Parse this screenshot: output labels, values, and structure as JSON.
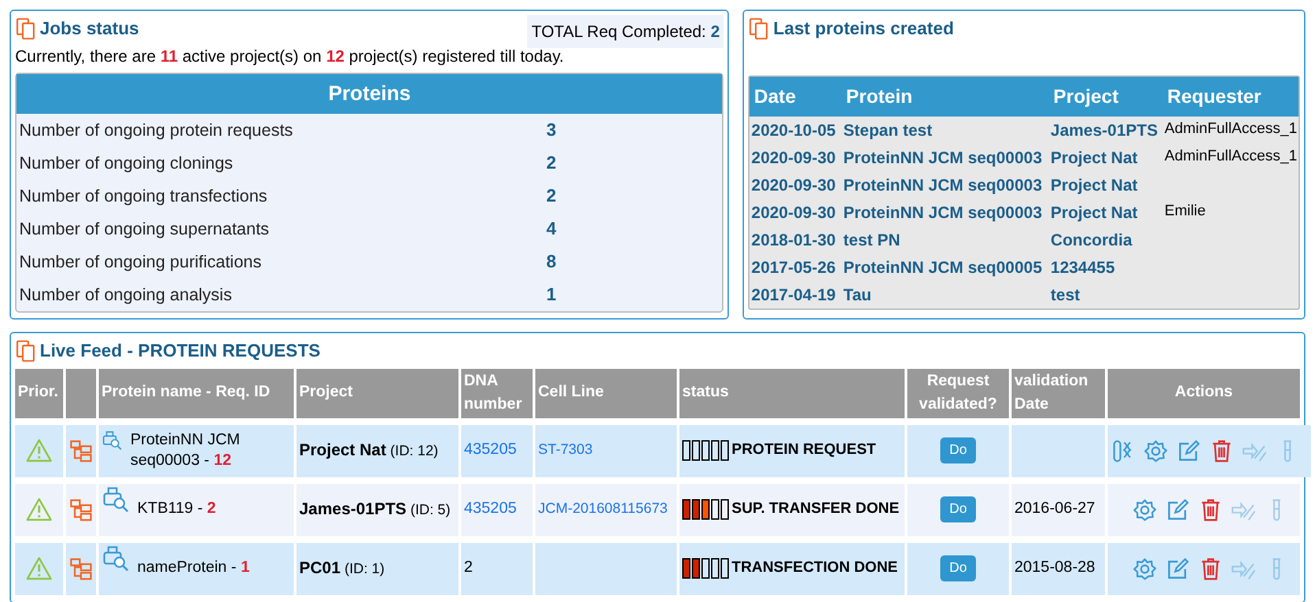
{
  "jobs_status": {
    "title": "Jobs status",
    "total_label": "TOTAL Req Completed:",
    "total_value": "2",
    "summary": {
      "before": "Currently, there are",
      "active": "11",
      "middle": "active project(s) on",
      "registered": "12",
      "after": "project(s) registered till today."
    },
    "table_title": "Proteins",
    "rows": [
      {
        "label": "Number of ongoing protein requests",
        "value": "3"
      },
      {
        "label": "Number of ongoing clonings",
        "value": "2"
      },
      {
        "label": "Number of ongoing transfections",
        "value": "2"
      },
      {
        "label": "Number of ongoing supernatants",
        "value": "4"
      },
      {
        "label": "Number of ongoing purifications",
        "value": "8"
      },
      {
        "label": "Number of ongoing analysis",
        "value": "1"
      }
    ]
  },
  "last_proteins": {
    "title": "Last proteins created",
    "columns": [
      "Date",
      "Protein",
      "Project",
      "Requester"
    ],
    "rows": [
      [
        "2020-10-05",
        "Stepan test",
        "James-01PTS",
        "AdminFullAccess_1"
      ],
      [
        "2020-09-30",
        "ProteinNN JCM seq00003",
        "Project Nat",
        "AdminFullAccess_1"
      ],
      [
        "2020-09-30",
        "ProteinNN JCM seq00003",
        "Project Nat",
        ""
      ],
      [
        "2020-09-30",
        "ProteinNN JCM seq00003",
        "Project Nat",
        "Emilie"
      ],
      [
        "2018-01-30",
        "test PN",
        "Concordia",
        ""
      ],
      [
        "2017-05-26",
        "ProteinNN JCM seq00005",
        "1234455",
        ""
      ],
      [
        "2017-04-19",
        "Tau",
        "test",
        ""
      ]
    ]
  },
  "live_feed": {
    "title": "Live Feed - PROTEIN REQUESTS",
    "columns": [
      "Prior.",
      "",
      "Protein name - Req. ID",
      "Project",
      "DNA number",
      "Cell Line",
      "status",
      "Request validated?",
      "validation Date",
      "Actions"
    ],
    "rows": [
      {
        "protein": "ProteinNN JCM seq00003 -",
        "req_id": "12",
        "project": "**Project Nat** (ID: 12)",
        "dna": "435205",
        "dna_link": true,
        "cell_line": "ST-7303",
        "steps": [
          {
            "done": false
          },
          {
            "done": false
          },
          {
            "done": false
          },
          {
            "done": false
          },
          {
            "done": false
          }
        ],
        "status": "PROTEIN REQUEST",
        "validate": "Do",
        "validation_date": "",
        "actions": [
          {
            "kind": "tubes",
            "disabled": false
          },
          {
            "kind": "settings",
            "disabled": false
          },
          {
            "kind": "edit",
            "disabled": false
          },
          {
            "kind": "delete",
            "disabled": false
          },
          {
            "kind": "transfer",
            "disabled": true
          },
          {
            "kind": "tube",
            "disabled": true
          }
        ]
      },
      {
        "protein": "KTB119 -",
        "req_id": "2",
        "project": "**James-01PTS** (ID: 5)",
        "dna": "435205",
        "dna_link": true,
        "cell_line": "JCM-201608115673",
        "steps": [
          {
            "done": true
          },
          {
            "done": true
          },
          {
            "done": true
          },
          {
            "done": false
          },
          {
            "done": false
          }
        ],
        "status": "SUP. TRANSFER DONE",
        "validate": "Do",
        "validation_date": "2016-06-27",
        "actions": [
          {
            "kind": "settings",
            "disabled": false
          },
          {
            "kind": "edit",
            "disabled": false
          },
          {
            "kind": "delete",
            "disabled": false
          },
          {
            "kind": "transfer",
            "disabled": true
          },
          {
            "kind": "tube",
            "disabled": true
          }
        ]
      },
      {
        "protein": "nameProtein -",
        "req_id": "1",
        "project": "**PC01** (ID: 1)",
        "dna": "2",
        "dna_link": false,
        "cell_line": "",
        "steps": [
          {
            "done": true
          },
          {
            "done": true
          },
          {
            "done": false
          },
          {
            "done": false
          },
          {
            "done": false
          }
        ],
        "status": "TRANSFECTION DONE",
        "validate": "Do",
        "validation_date": "2015-08-28",
        "actions": [
          {
            "kind": "settings",
            "disabled": false
          },
          {
            "kind": "edit",
            "disabled": false
          },
          {
            "kind": "delete",
            "disabled": false
          },
          {
            "kind": "transfer",
            "disabled": true
          },
          {
            "kind": "tube",
            "disabled": true
          }
        ]
      }
    ]
  }
}
